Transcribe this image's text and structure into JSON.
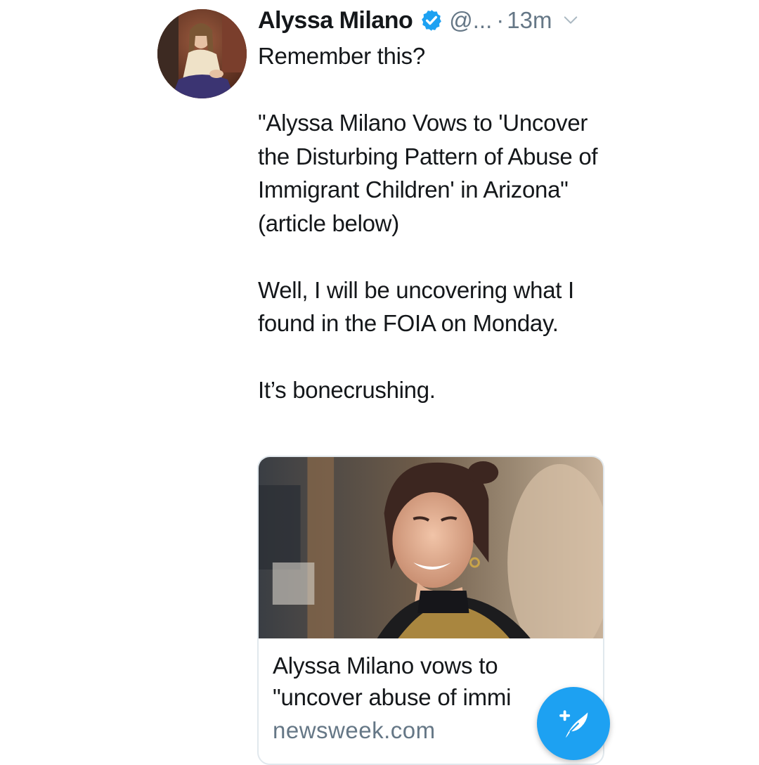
{
  "colors": {
    "accent": "#1da1f2",
    "text_primary": "#14171a",
    "text_secondary": "#657786",
    "border": "#e1e8ed"
  },
  "tweet": {
    "author_name": "Alyssa Milano",
    "handle": "@...",
    "separator": "·",
    "timestamp": "13m",
    "paragraphs": [
      "Remember this?",
      "\"Alyssa Milano Vows to 'Uncover the Disturbing Pattern of Abuse of Immigrant Children' in Arizona\" (article below)",
      "Well, I will be uncovering what I found in the FOIA on Monday.",
      "It’s bonecrushing."
    ]
  },
  "card": {
    "title_line1": "Alyssa Milano vows to",
    "title_line2": "\"uncover abuse of immi",
    "domain": "newsweek.com"
  },
  "icons": {
    "verified": "verified-badge-icon",
    "chevron": "chevron-down-icon",
    "compose": "compose-tweet-icon"
  }
}
